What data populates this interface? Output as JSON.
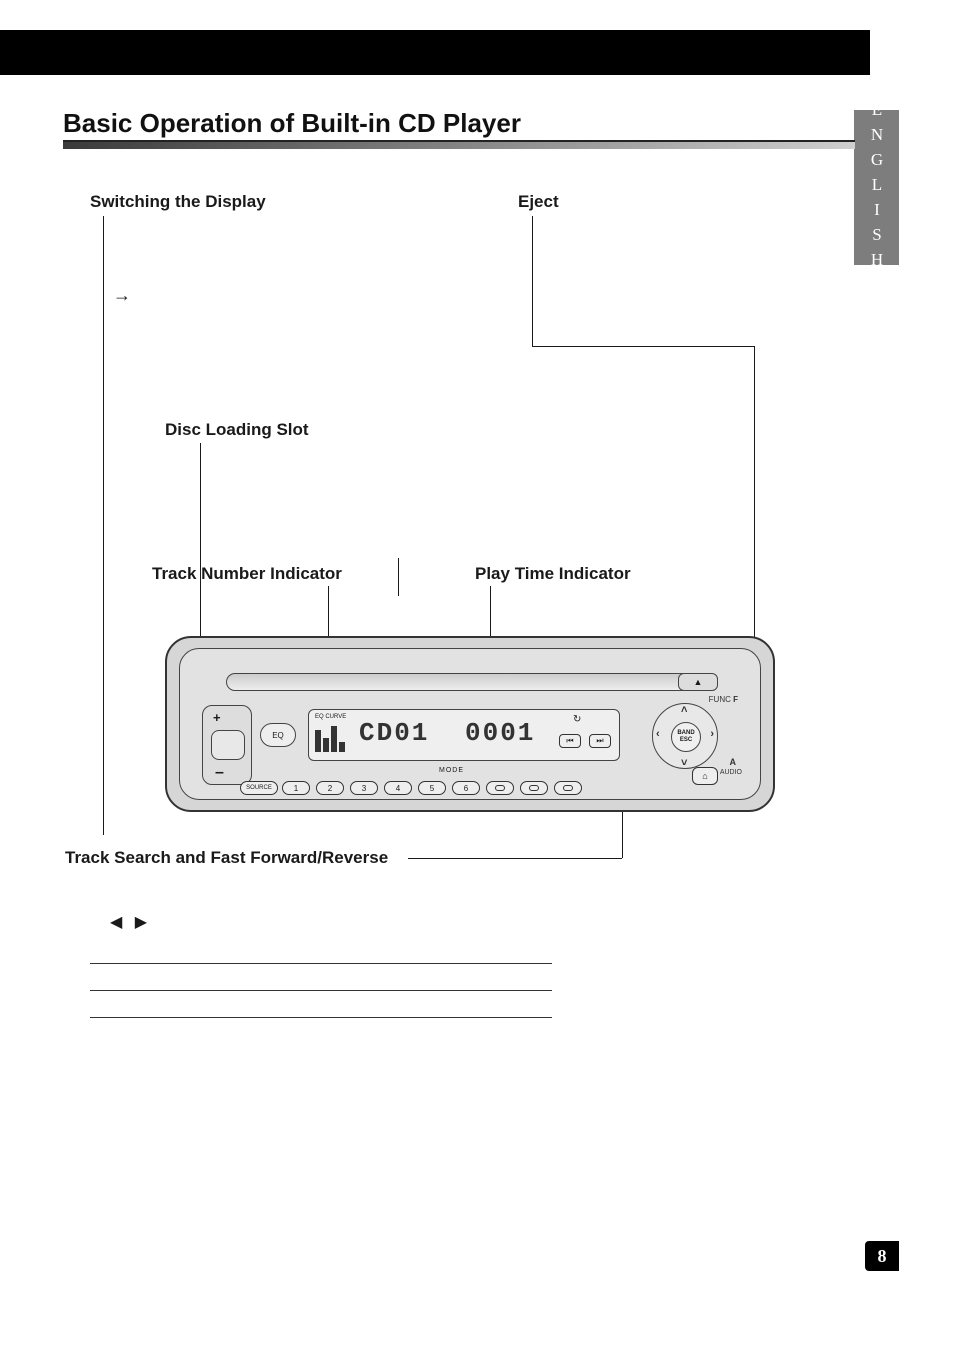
{
  "header": {
    "black_bar": true
  },
  "language_tab": "ENGLISH",
  "section_title": "Basic Operation of Built-in CD Player",
  "labels": {
    "switching_display": "Switching the Display",
    "eject": "Eject",
    "disc_loading_slot": "Disc Loading Slot",
    "track_number_indicator": "Track Number Indicator",
    "play_time_indicator": "Play Time Indicator",
    "track_search_ff_rev": "Track Search and Fast Forward/Reverse"
  },
  "glyphs": {
    "arrow_right": "→",
    "playback_prev_next": "◀ ▶",
    "eject_icon": "▲",
    "prev_icon": "⏮",
    "next_icon": "⏭",
    "loop_icon": "↻",
    "home_icon": "⌂",
    "dpad_up": "˄",
    "dpad_down": "˅",
    "dpad_left": "‹",
    "dpad_right": "›",
    "vol_plus": "+",
    "vol_minus": "–"
  },
  "stereo": {
    "lcd": {
      "eq_label": "EQ CURVE",
      "cd_text": "CD01",
      "time_text": "0001",
      "mode_label": "MODE"
    },
    "eq_button": "EQ",
    "source_button": "SOURCE",
    "func_label": "FUNC",
    "f_label": "F",
    "a_label": "A",
    "audio_label": "AUDIO",
    "dpad_center_line1": "BAND",
    "dpad_center_line2": "ESC",
    "preset_buttons": [
      "1",
      "2",
      "3",
      "4",
      "5",
      "6"
    ]
  },
  "page_number": "8"
}
